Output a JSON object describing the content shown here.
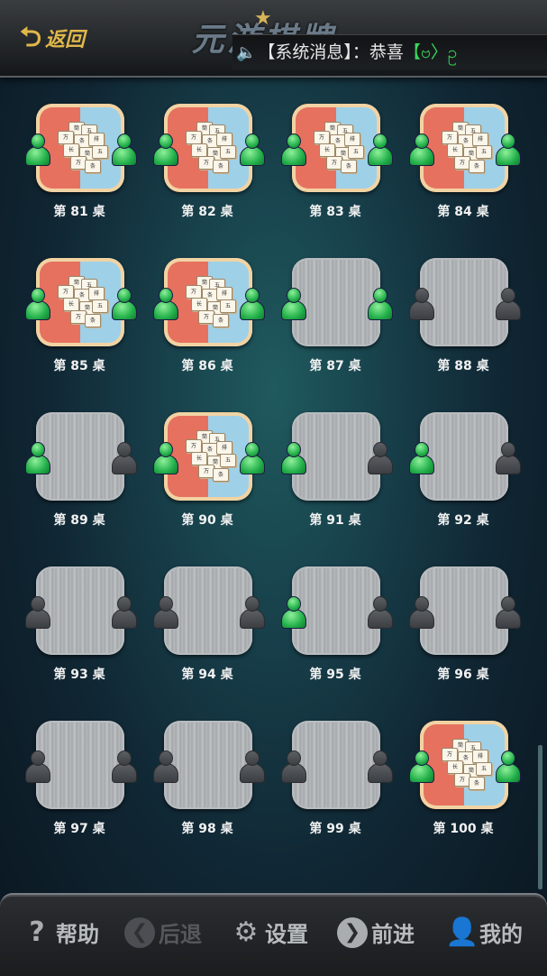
{
  "header": {
    "back_label": "返回",
    "logo_text": "元游棋牌",
    "message": {
      "prefix": "【系统消息】：恭喜",
      "tag": "【ဗ〉ဥ"
    }
  },
  "tables": [
    {
      "label": "第 81 桌",
      "state": "playing",
      "left_seat": "occupied",
      "right_seat": "occupied"
    },
    {
      "label": "第 82 桌",
      "state": "playing",
      "left_seat": "occupied",
      "right_seat": "occupied"
    },
    {
      "label": "第 83 桌",
      "state": "playing",
      "left_seat": "occupied",
      "right_seat": "occupied"
    },
    {
      "label": "第 84 桌",
      "state": "playing",
      "left_seat": "occupied",
      "right_seat": "occupied"
    },
    {
      "label": "第 85 桌",
      "state": "playing",
      "left_seat": "occupied",
      "right_seat": "occupied"
    },
    {
      "label": "第 86 桌",
      "state": "playing",
      "left_seat": "occupied",
      "right_seat": "occupied"
    },
    {
      "label": "第 87 桌",
      "state": "empty",
      "left_seat": "occupied",
      "right_seat": "occupied"
    },
    {
      "label": "第 88 桌",
      "state": "empty",
      "left_seat": "vacant",
      "right_seat": "vacant"
    },
    {
      "label": "第 89 桌",
      "state": "empty",
      "left_seat": "occupied",
      "right_seat": "vacant"
    },
    {
      "label": "第 90 桌",
      "state": "playing",
      "left_seat": "occupied",
      "right_seat": "occupied"
    },
    {
      "label": "第 91 桌",
      "state": "empty",
      "left_seat": "occupied",
      "right_seat": "vacant"
    },
    {
      "label": "第 92 桌",
      "state": "empty",
      "left_seat": "occupied",
      "right_seat": "vacant"
    },
    {
      "label": "第 93 桌",
      "state": "empty",
      "left_seat": "vacant",
      "right_seat": "vacant"
    },
    {
      "label": "第 94 桌",
      "state": "empty",
      "left_seat": "vacant",
      "right_seat": "vacant"
    },
    {
      "label": "第 95 桌",
      "state": "empty",
      "left_seat": "occupied",
      "right_seat": "vacant"
    },
    {
      "label": "第 96 桌",
      "state": "empty",
      "left_seat": "vacant",
      "right_seat": "vacant"
    },
    {
      "label": "第 97 桌",
      "state": "empty",
      "left_seat": "vacant",
      "right_seat": "vacant"
    },
    {
      "label": "第 98 桌",
      "state": "empty",
      "left_seat": "vacant",
      "right_seat": "vacant"
    },
    {
      "label": "第 99 桌",
      "state": "empty",
      "left_seat": "vacant",
      "right_seat": "vacant"
    },
    {
      "label": "第 100 桌",
      "state": "playing",
      "left_seat": "occupied",
      "right_seat": "occupied"
    }
  ],
  "tile_glyphs": [
    "筒",
    "五",
    "万",
    "条",
    "排",
    "长"
  ],
  "bottom_nav": [
    {
      "label": "帮助",
      "icon": "question-icon",
      "enabled": true
    },
    {
      "label": "后退",
      "icon": "back-arrow-icon",
      "enabled": false
    },
    {
      "label": "设置",
      "icon": "gear-icon",
      "enabled": true
    },
    {
      "label": "前进",
      "icon": "forward-arrow-icon",
      "enabled": true
    },
    {
      "label": "我的",
      "icon": "user-icon",
      "enabled": true
    }
  ],
  "colors": {
    "accent": "#e0b84a",
    "seat_occupied": "#22b04a",
    "message_tag": "#39d85a"
  }
}
